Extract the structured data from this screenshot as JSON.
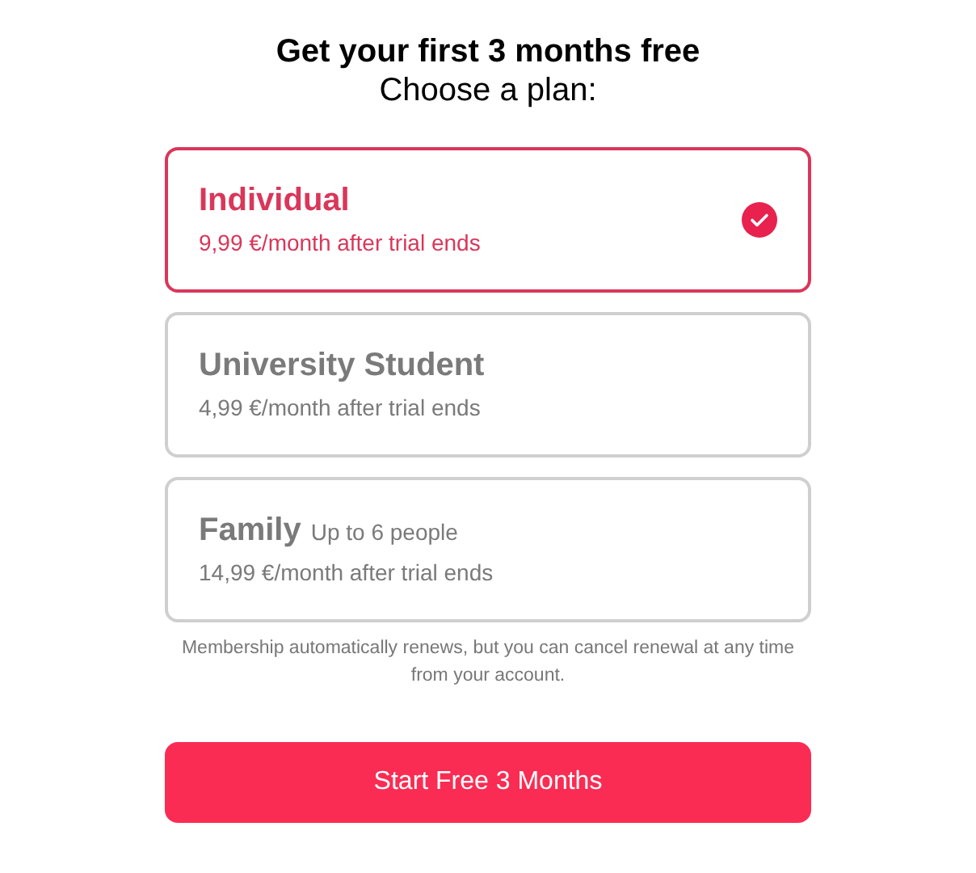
{
  "title": "Get your first 3 months free",
  "subtitle": "Choose a plan:",
  "plans": [
    {
      "name": "Individual",
      "price": "9,99 €/month after trial ends",
      "selected": true
    },
    {
      "name": "University Student",
      "price": "4,99 €/month after trial ends",
      "selected": false
    },
    {
      "name": "Family",
      "note": "Up to 6 people",
      "price": "14,99 €/month after trial ends",
      "selected": false
    }
  ],
  "disclaimer": "Membership automatically renews, but you can cancel renewal at any time from your account.",
  "button": "Start Free 3 Months"
}
